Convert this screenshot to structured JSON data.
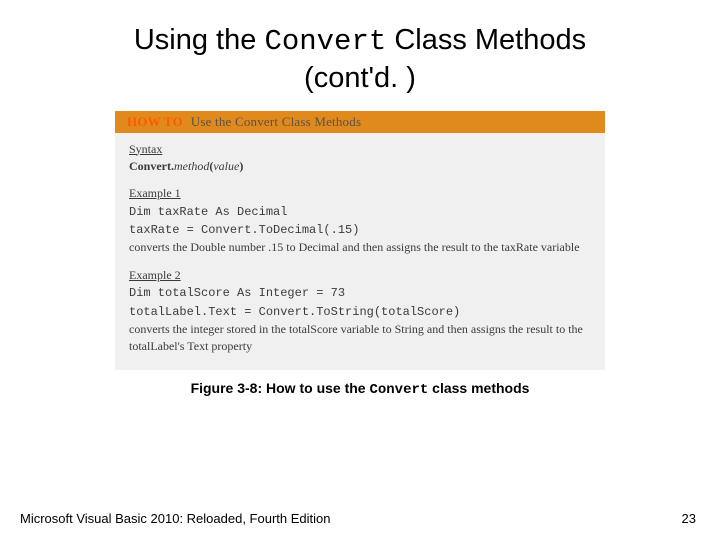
{
  "title": {
    "pre": "Using the ",
    "mono": "Convert",
    "post": " Class Methods",
    "line2": "(cont'd. )"
  },
  "howto": {
    "label": "HOW TO",
    "heading": "Use the Convert Class Methods"
  },
  "syntax": {
    "label": "Syntax",
    "cls": "Convert.",
    "method": "method",
    "open": "(",
    "arg": "value",
    "close": ")"
  },
  "ex1": {
    "label": "Example 1",
    "code1": "Dim taxRate As Decimal",
    "code2": "taxRate = Convert.ToDecimal(.15)",
    "desc": "converts the Double number .15 to Decimal and then assigns the result to the taxRate variable"
  },
  "ex2": {
    "label": "Example 2",
    "code1": "Dim totalScore As Integer = 73",
    "code2": "totalLabel.Text = Convert.ToString(totalScore)",
    "desc": "converts the integer stored in the totalScore variable to String and then assigns the result to the totalLabel's Text property"
  },
  "caption": {
    "pre": "Figure 3-8: How to use the ",
    "mono": "Convert",
    "post": " class methods"
  },
  "footer": {
    "left": "Microsoft Visual Basic 2010: Reloaded, Fourth Edition",
    "right": "23"
  }
}
